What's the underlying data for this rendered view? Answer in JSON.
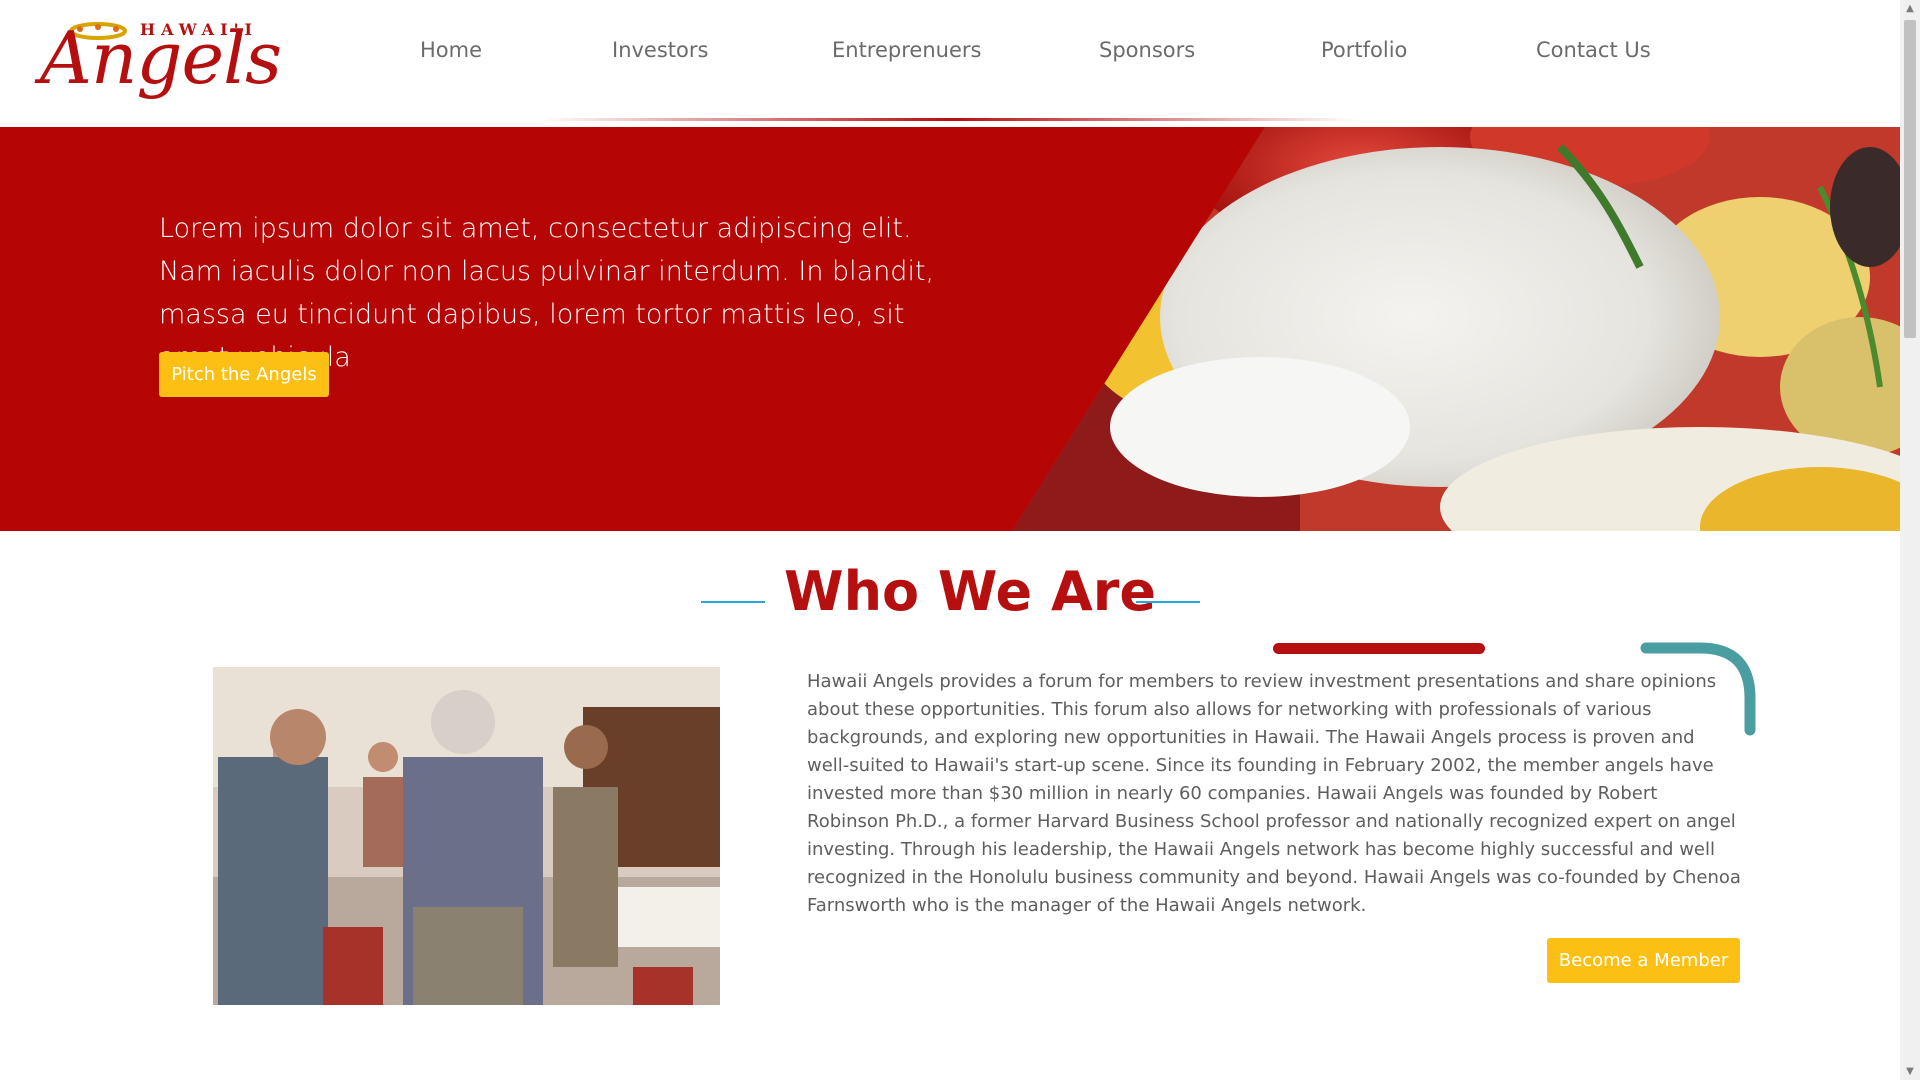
{
  "brand": {
    "logo_top": "HAWAI'I",
    "logo_main": "Angels",
    "color": "#b50f0f"
  },
  "nav": {
    "items": [
      {
        "label": "Home"
      },
      {
        "label": "Investors"
      },
      {
        "label": "Entreprenuers"
      },
      {
        "label": "Sponsors"
      },
      {
        "label": "Portfolio"
      },
      {
        "label": "Contact Us"
      }
    ]
  },
  "hero": {
    "text": "Lorem ipsum dolor sit amet, consectetur adipiscing elit. Nam iaculis dolor non lacus pulvinar interdum. In blandit, massa eu tincidunt dapibus, lorem tortor mattis leo, sit amet vehicula",
    "cta_label": "Pitch the Angels",
    "background_color": "#b50505",
    "cta_color": "#fbc013"
  },
  "about": {
    "title": "Who We Are",
    "body": "Hawaii Angels provides a forum for members to review investment presentations and share opinions about these opportunities. This forum also allows for networking with professionals of various backgrounds, and exploring new opportunities in Hawaii. The Hawaii Angels process is proven and well-suited to Hawaii's start-up scene. Since its founding in February 2002, the member angels have invested more than $30 million in nearly 60 companies. Hawaii Angels was founded by Robert Robinson Ph.D., a former Harvard Business School professor and nationally recognized expert on angel investing. Through his leadership, the Hawaii Angels network has become highly successful and well recognized in the Honolulu business community and beyond. Hawaii Angels was co-founded by Chenoa Farnsworth who is the manager of the Hawaii Angels network.",
    "cta_label": "Become a Member",
    "title_line_color": "#2aa6dd",
    "accent_teal": "#4a9da0"
  },
  "icons": {
    "scroll_up": "▲",
    "scroll_down": "▼"
  }
}
